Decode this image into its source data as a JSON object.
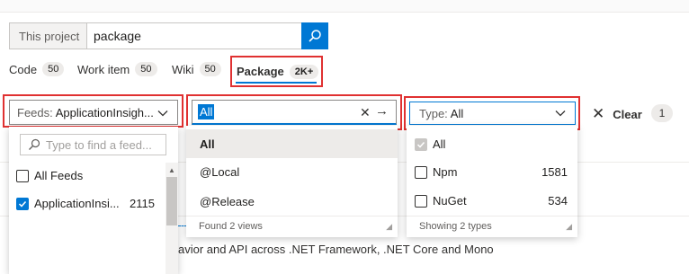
{
  "search": {
    "scope": "This project",
    "query": "package"
  },
  "tabs": [
    {
      "label": "Code",
      "count": "50"
    },
    {
      "label": "Work item",
      "count": "50"
    },
    {
      "label": "Wiki",
      "count": "50"
    },
    {
      "label": "Package",
      "count": "2K+"
    }
  ],
  "filters": {
    "feeds": {
      "label": "Feeds:",
      "value": "ApplicationInsigh..."
    },
    "views": {
      "value": "All"
    },
    "type": {
      "label": "Type:",
      "value": "All"
    },
    "clear_label": "Clear",
    "active_count": "1"
  },
  "feeds_panel": {
    "placeholder": "Type to find a feed...",
    "items": [
      {
        "label": "All Feeds",
        "checked": false,
        "count": ""
      },
      {
        "label": "ApplicationInsi...",
        "checked": true,
        "count": "2115"
      }
    ]
  },
  "views_panel": {
    "items": [
      "All",
      "@Local",
      "@Release"
    ],
    "footer": "Found 2 views"
  },
  "types_panel": {
    "items": [
      {
        "label": "All",
        "checked": true,
        "count": ""
      },
      {
        "label": "Npm",
        "checked": false,
        "count": "1581"
      },
      {
        "label": "NuGet",
        "checked": false,
        "count": "534"
      }
    ],
    "footer": "Showing 2 types"
  },
  "result_snippet": "avior and API across .NET Framework, .NET Core and Mono",
  "colors": {
    "accent": "#0078d4",
    "highlight": "#e03131"
  }
}
